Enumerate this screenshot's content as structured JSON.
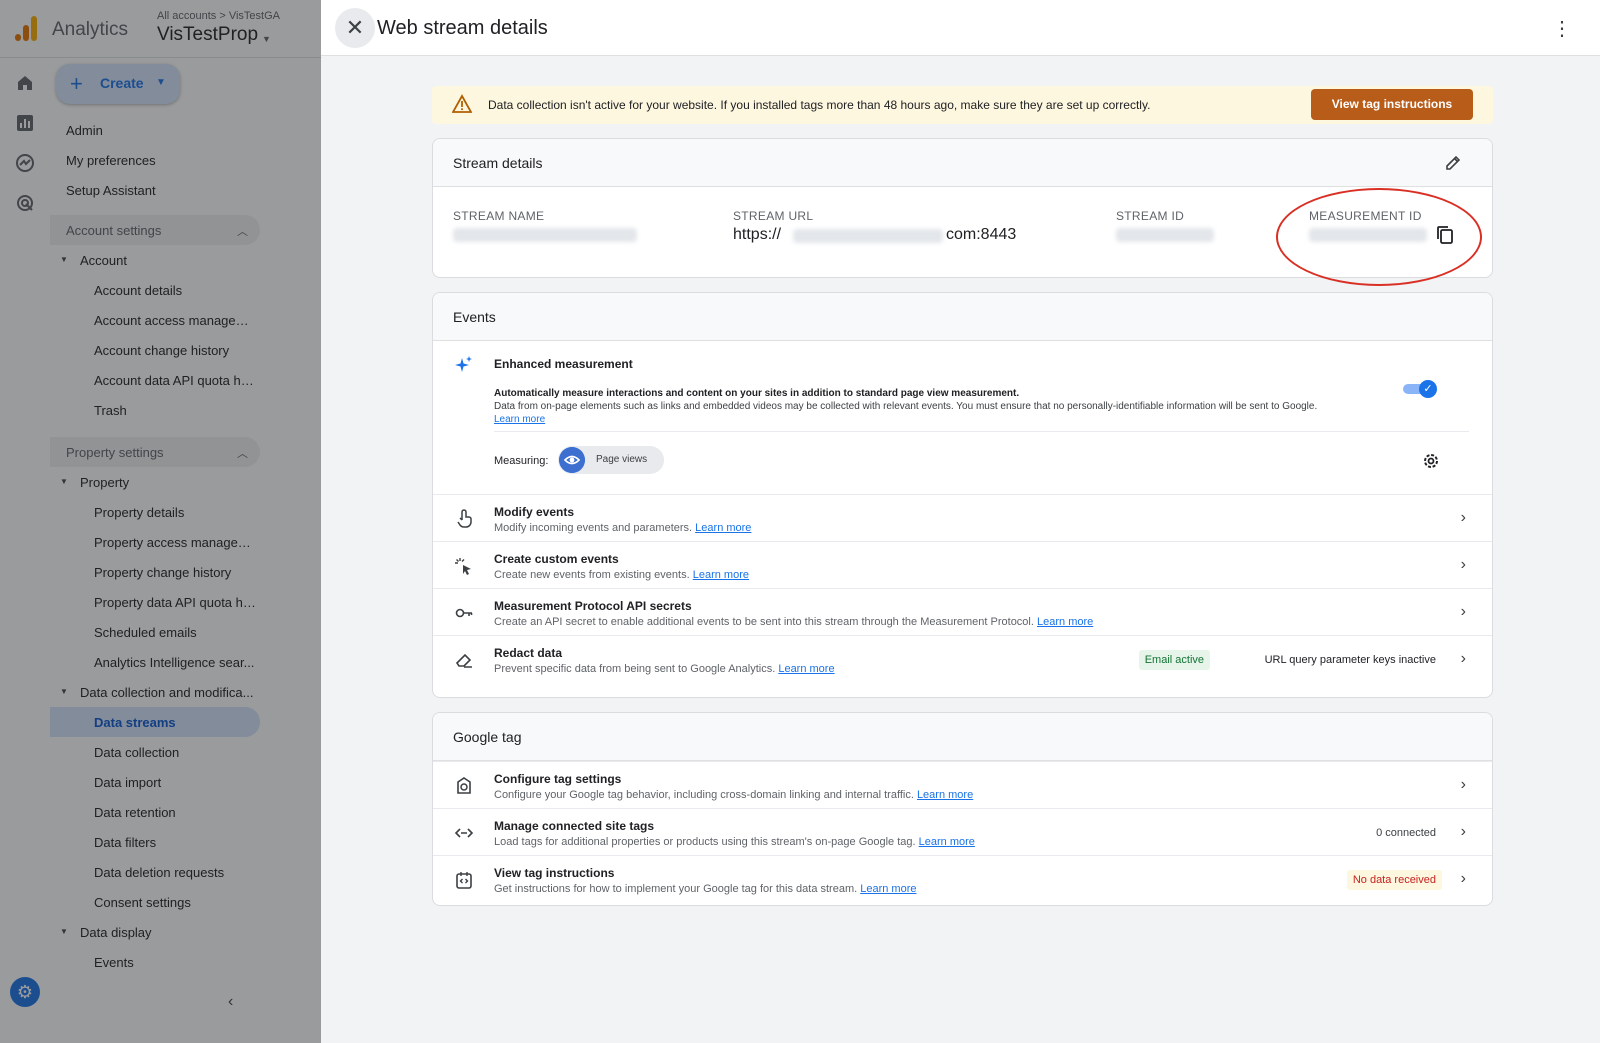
{
  "app": {
    "product_name": "Analytics",
    "breadcrumb": "All accounts > VisTestGA",
    "property_name": "VisTestProp",
    "create_label": "Create"
  },
  "nav": {
    "items": [
      {
        "label": "Admin",
        "kind": "lvl0"
      },
      {
        "label": "My preferences",
        "kind": "lvl0"
      },
      {
        "label": "Setup Assistant",
        "kind": "lvl0"
      },
      {
        "label": "Account settings",
        "kind": "section"
      },
      {
        "label": "Account",
        "kind": "lvl1"
      },
      {
        "label": "Account details",
        "kind": "lvl2"
      },
      {
        "label": "Account access managem...",
        "kind": "lvl2"
      },
      {
        "label": "Account change history",
        "kind": "lvl2"
      },
      {
        "label": "Account data API quota his...",
        "kind": "lvl2"
      },
      {
        "label": "Trash",
        "kind": "lvl2"
      },
      {
        "label": "Property settings",
        "kind": "section"
      },
      {
        "label": "Property",
        "kind": "lvl1"
      },
      {
        "label": "Property details",
        "kind": "lvl2"
      },
      {
        "label": "Property access managem...",
        "kind": "lvl2"
      },
      {
        "label": "Property change history",
        "kind": "lvl2"
      },
      {
        "label": "Property data API quota hi...",
        "kind": "lvl2"
      },
      {
        "label": "Scheduled emails",
        "kind": "lvl2"
      },
      {
        "label": "Analytics Intelligence sear...",
        "kind": "lvl2"
      },
      {
        "label": "Data collection and modifica...",
        "kind": "lvl1"
      },
      {
        "label": "Data streams",
        "kind": "lvl2"
      },
      {
        "label": "Data collection",
        "kind": "lvl2"
      },
      {
        "label": "Data import",
        "kind": "lvl2"
      },
      {
        "label": "Data retention",
        "kind": "lvl2"
      },
      {
        "label": "Data filters",
        "kind": "lvl2"
      },
      {
        "label": "Data deletion requests",
        "kind": "lvl2"
      },
      {
        "label": "Consent settings",
        "kind": "lvl2"
      },
      {
        "label": "Data display",
        "kind": "lvl1"
      },
      {
        "label": "Events",
        "kind": "lvl2"
      }
    ],
    "selected": "Data streams"
  },
  "drawer": {
    "title": "Web stream details",
    "alert": {
      "message": "Data collection isn't active for your website. If you installed tags more than 48 hours ago, make sure they are set up correctly.",
      "button": "View tag instructions"
    },
    "stream_details": {
      "header": "Stream details",
      "name_label": "STREAM NAME",
      "url_label": "STREAM URL",
      "url_prefix": "https://",
      "url_suffix": "com:8443",
      "id_label": "STREAM ID",
      "measurement_label": "MEASUREMENT ID"
    },
    "events": {
      "header": "Events",
      "enhanced": {
        "title": "Enhanced measurement",
        "line1": "Automatically measure interactions and content on your sites in addition to standard page view measurement.",
        "line2": "Data from on-page elements such as links and embedded videos may be collected with relevant events. You must ensure that no personally-identifiable information will be sent to Google.",
        "learn_more": "Learn more",
        "measuring_label": "Measuring:",
        "chip": "Page views",
        "enabled": true
      },
      "rows": [
        {
          "title": "Modify events",
          "desc": "Modify incoming events and parameters.",
          "link": "Learn more"
        },
        {
          "title": "Create custom events",
          "desc": "Create new events from existing events.",
          "link": "Learn more"
        },
        {
          "title": "Measurement Protocol API secrets",
          "desc": "Create an API secret to enable additional events to be sent into this stream through the Measurement Protocol.",
          "link": "Learn more"
        },
        {
          "title": "Redact data",
          "desc": "Prevent specific data from being sent to Google Analytics.",
          "link": "Learn more",
          "badge1": "Email active",
          "badge2": "URL query parameter keys inactive"
        }
      ]
    },
    "google_tag": {
      "header": "Google tag",
      "rows": [
        {
          "title": "Configure tag settings",
          "desc": "Configure your Google tag behavior, including cross-domain linking and internal traffic.",
          "link": "Learn more"
        },
        {
          "title": "Manage connected site tags",
          "desc": "Load tags for additional properties or products using this stream's on-page Google tag.",
          "link": "Learn more",
          "badge": "0 connected"
        },
        {
          "title": "View tag instructions",
          "desc": "Get instructions for how to implement your Google tag for this data stream.",
          "link": "Learn more",
          "badge": "No data received"
        }
      ]
    }
  },
  "colors": {
    "accent": "#1a73e8",
    "alert_bg": "#fef7e0",
    "alert_button": "#b85c1a",
    "highlight": "#d93025",
    "badge_green_bg": "#e6f4ea",
    "badge_orange_bg": "#fef7e0"
  }
}
